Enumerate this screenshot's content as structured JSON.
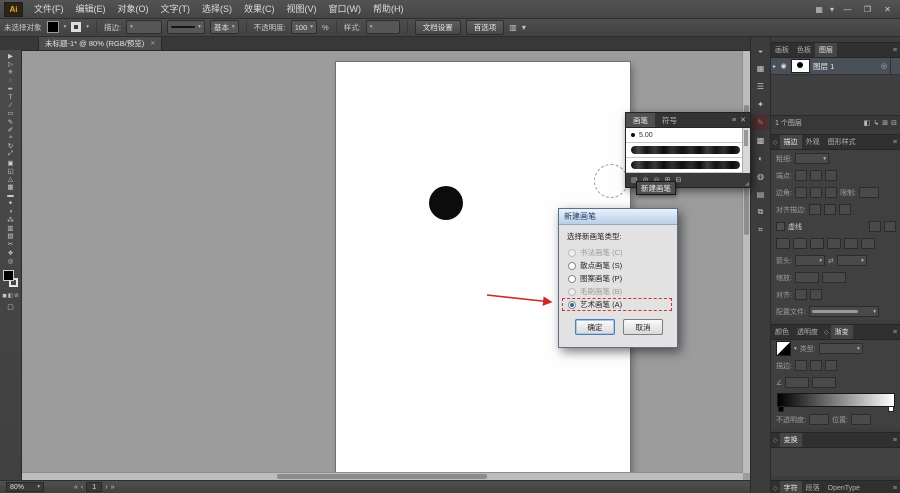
{
  "annotations": {
    "arrow_color": "#cc2a2a",
    "highlight_color": "#d03232"
  },
  "ui": {
    "caret": "▾"
  },
  "window": {
    "logo": "Ai",
    "minimize": "—",
    "restore": "❐",
    "close": "✕"
  },
  "menubar": {
    "items": [
      "文件(F)",
      "编辑(E)",
      "对象(O)",
      "文字(T)",
      "选择(S)",
      "效果(C)",
      "视图(V)",
      "窗口(W)",
      "帮助(H)"
    ],
    "right_icons": [
      {
        "name": "arrange-documents-icon",
        "glyph": "▦"
      },
      {
        "name": "workspace-menu-icon",
        "glyph": "▾"
      }
    ]
  },
  "controlbar": {
    "no_selection_label": "未选择对象",
    "stroke_label": "描边:",
    "brush_definition": "基本",
    "opacity_label": "不透明度:",
    "opacity_value": "100",
    "opacity_suffix": "%",
    "style_label": "样式:",
    "document_setup_button": "文档设置",
    "preferences_button": "首选项",
    "right_icons": [
      {
        "name": "align-panel-icon",
        "glyph": "▥"
      },
      {
        "name": "more-options-icon",
        "glyph": "▾"
      }
    ]
  },
  "document_tab": {
    "title": "未标题-1* @ 80% (RGB/预览)",
    "close_glyph": "✕"
  },
  "tools": [
    {
      "name": "selection-tool",
      "glyph": "▶"
    },
    {
      "name": "direct-selection-tool",
      "glyph": "▷"
    },
    {
      "name": "magic-wand-tool",
      "glyph": "✳"
    },
    {
      "name": "lasso-tool",
      "glyph": "◌"
    },
    {
      "name": "pen-tool",
      "glyph": "✒"
    },
    {
      "name": "type-tool",
      "glyph": "T"
    },
    {
      "name": "line-segment-tool",
      "glyph": "∕"
    },
    {
      "name": "rectangle-tool",
      "glyph": "▭"
    },
    {
      "name": "paintbrush-tool",
      "glyph": "✎"
    },
    {
      "name": "pencil-tool",
      "glyph": "✐"
    },
    {
      "name": "width-tool",
      "glyph": "≈"
    },
    {
      "name": "rotate-tool",
      "glyph": "↻"
    },
    {
      "name": "scale-tool",
      "glyph": "⤢"
    },
    {
      "name": "free-transform-tool",
      "glyph": "▣"
    },
    {
      "name": "shape-builder-tool",
      "glyph": "◱"
    },
    {
      "name": "perspective-grid-tool",
      "glyph": "△"
    },
    {
      "name": "mesh-tool",
      "glyph": "▦"
    },
    {
      "name": "gradient-tool",
      "glyph": "▬"
    },
    {
      "name": "eyedropper-tool",
      "glyph": "✦"
    },
    {
      "name": "blend-tool",
      "glyph": "◑"
    },
    {
      "name": "symbol-sprayer-tool",
      "glyph": "⁂"
    },
    {
      "name": "column-graph-tool",
      "glyph": "▥"
    },
    {
      "name": "artboard-tool",
      "glyph": "▤"
    },
    {
      "name": "slice-tool",
      "glyph": "✂"
    },
    {
      "name": "hand-tool",
      "glyph": "❖"
    },
    {
      "name": "zoom-tool",
      "glyph": "◎"
    }
  ],
  "brushes_panel": {
    "tabs": [
      {
        "label": "画笔"
      },
      {
        "label": "符号"
      }
    ],
    "panel_menu_glyph": "≡",
    "close_glyph": "✕",
    "items": [
      {
        "label": "5.00"
      }
    ],
    "footer_icons": [
      {
        "name": "brush-libraries-icon",
        "glyph": "▤"
      },
      {
        "name": "remove-brush-stroke-icon",
        "glyph": "⊘"
      },
      {
        "name": "options-of-selected-object-icon",
        "glyph": "◎"
      },
      {
        "name": "new-brush-icon",
        "glyph": "⊞"
      },
      {
        "name": "delete-brush-icon",
        "glyph": "⊟"
      }
    ]
  },
  "tooltip": {
    "text": "新建画笔"
  },
  "dialog": {
    "title": "新建画笔",
    "prompt": "选择新画笔类型:",
    "options": [
      {
        "label": "书法画笔 (C)",
        "disabled": true
      },
      {
        "label": "散点画笔 (S)"
      },
      {
        "label": "图案画笔 (P)"
      },
      {
        "label": "毛刷画笔 (B)",
        "disabled": true
      },
      {
        "label": "艺术画笔 (A)",
        "selected": true,
        "highlighted": true
      }
    ],
    "ok_button": "确定",
    "cancel_button": "取消"
  },
  "dock_icons": [
    {
      "name": "color-panel-icon",
      "glyph": "◒"
    },
    {
      "name": "swatches-panel-icon",
      "glyph": "▦"
    },
    {
      "name": "stroke-panel-icon",
      "glyph": "☰"
    },
    {
      "name": "symbols-panel-icon",
      "glyph": "✦"
    },
    {
      "name": "brushes-panel-icon",
      "glyph": "✎",
      "active": true
    },
    {
      "name": "gradient-panel-icon",
      "glyph": "▩"
    },
    {
      "name": "transparency-panel-icon",
      "glyph": "◐"
    },
    {
      "name": "appearance-panel-icon",
      "glyph": "◍"
    },
    {
      "name": "graphic-styles-panel-icon",
      "glyph": "▤"
    },
    {
      "name": "links-panel-icon",
      "glyph": "⧉"
    },
    {
      "name": "navigator-panel-icon",
      "glyph": "⌗"
    }
  ],
  "layers_panel": {
    "tabs": [
      {
        "label": "画板"
      },
      {
        "label": "色板"
      },
      {
        "label": "图层",
        "active": true
      }
    ],
    "panel_menu_glyph": "≡",
    "layer": {
      "expand_glyph": "▸",
      "eye_glyph": "◉",
      "name": "图层 1",
      "target_glyph": "◎"
    },
    "footer_text": "1 个图层",
    "footer_icons": [
      {
        "name": "make-clipping-mask-icon",
        "glyph": "◧"
      },
      {
        "name": "new-sublayer-icon",
        "glyph": "↳"
      },
      {
        "name": "new-layer-icon",
        "glyph": "⊞"
      },
      {
        "name": "delete-layer-icon",
        "glyph": "⊟"
      }
    ]
  },
  "stroke_panel": {
    "expander_glyph": "◇",
    "tabs": [
      {
        "label": "描边",
        "active": true
      },
      {
        "label": "外观"
      },
      {
        "label": "图形样式"
      }
    ],
    "panel_menu_glyph": "≡",
    "weight_label": "粗细:",
    "cap_label": "端点:",
    "corner_label": "边角:",
    "limit_label": "限制:",
    "align_stroke_label": "对齐描边:",
    "dashed_label": "虚线",
    "arrow_label": "箭头:",
    "swap_glyph": "⇄",
    "scale_label": "缩放:",
    "align_label": "对齐:",
    "profile_label": "配置文件:"
  },
  "gradient_panel": {
    "expander_glyph": "◇",
    "tabs": [
      {
        "label": "颜色"
      },
      {
        "label": "透明度"
      },
      {
        "label": "渐变",
        "active": true
      }
    ],
    "panel_menu_glyph": "≡",
    "type_label": "类型:",
    "stroke_label": "描边:",
    "angle_glyph": "∠",
    "opacity_label": "不透明度:",
    "position_label": "位置:"
  },
  "transform_panel": {
    "expander_glyph": "◇",
    "title": "变换",
    "panel_menu_glyph": "≡"
  },
  "type_panel": {
    "expander_glyph": "◇",
    "tabs": [
      {
        "label": "字符"
      },
      {
        "label": "段落"
      },
      {
        "label": "OpenType"
      }
    ],
    "panel_menu_glyph": "≡"
  },
  "statusbar": {
    "zoom": "80%",
    "nav": {
      "first": "«",
      "prev": "‹",
      "current": "1",
      "next": "›",
      "last": "»"
    }
  }
}
